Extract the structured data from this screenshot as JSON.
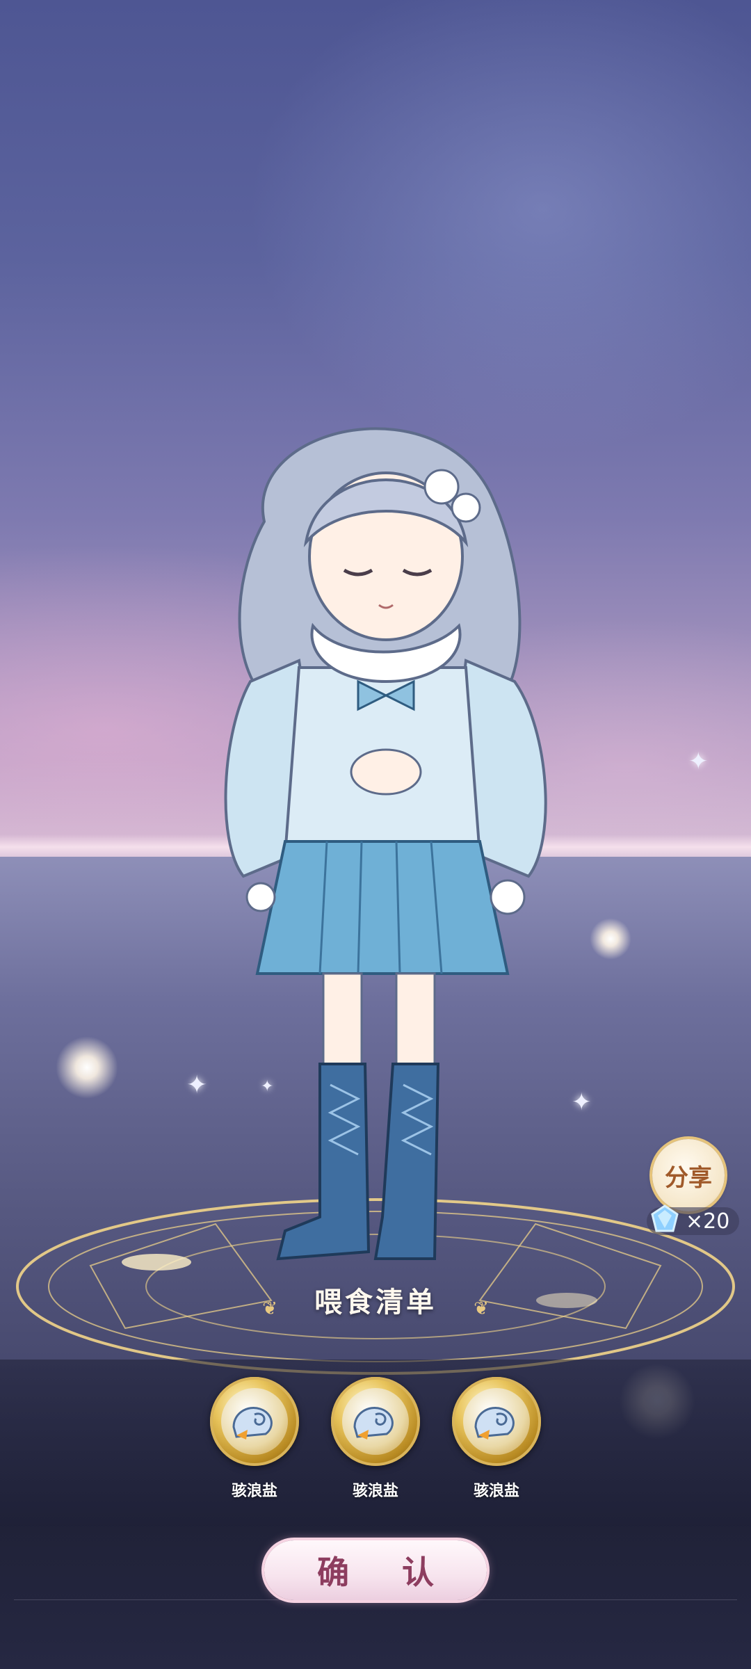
{
  "title": "喂食清单",
  "items": [
    {
      "name": "骇浪盐",
      "icon": "seaweed-salt-icon"
    },
    {
      "name": "骇浪盐",
      "icon": "seaweed-salt-icon"
    },
    {
      "name": "骇浪盐",
      "icon": "seaweed-salt-icon"
    }
  ],
  "confirm_label": "确 认",
  "share_label": "分享",
  "reward": {
    "icon": "diamond-icon",
    "amount": "×20"
  },
  "colors": {
    "accent_gold": "#e5c37b",
    "confirm_text": "#8d3d5f",
    "dress_blue": "#6fb0d6"
  }
}
